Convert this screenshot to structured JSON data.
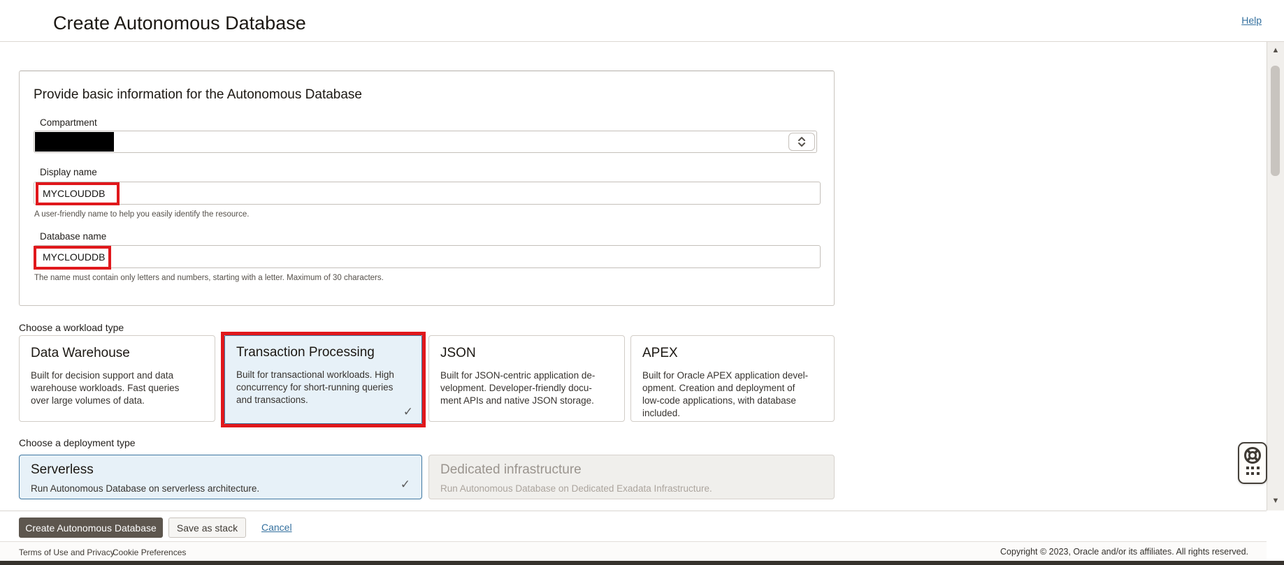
{
  "header": {
    "title": "Create Autonomous Database",
    "help_label": "Help"
  },
  "basic_info": {
    "heading": "Provide basic information for the Autonomous Database",
    "compartment": {
      "label": "Compartment"
    },
    "display_name": {
      "label": "Display name",
      "value": "MYCLOUDDB",
      "helper": "A user-friendly name to help you easily identify the resource."
    },
    "database_name": {
      "label": "Database name",
      "value": "MYCLOUDDB",
      "helper": "The name must contain only letters and numbers, starting with a letter. Maximum of 30 characters."
    }
  },
  "workload": {
    "label": "Choose a workload type",
    "cards": [
      {
        "title": "Data Warehouse",
        "description": [
          "Built for decision support and data",
          "warehouse workloads. Fast queries",
          "over large volumes of data."
        ],
        "selected": false
      },
      {
        "title": "Transaction Processing",
        "description": [
          "Built for transactional workloads. High",
          "concurrency for short-running queries",
          "and transactions."
        ],
        "selected": true
      },
      {
        "title": "JSON",
        "description": [
          "Built for JSON-centric application de-",
          "velopment. Developer-friendly docu-",
          "ment APIs and native JSON storage."
        ],
        "selected": false
      },
      {
        "title": "APEX",
        "description": [
          "Built for Oracle APEX application devel-",
          "opment. Creation and deployment of",
          "low-code applications, with database",
          "included."
        ],
        "selected": false
      }
    ]
  },
  "deployment": {
    "label": "Choose a deployment type",
    "cards": [
      {
        "title": "Serverless",
        "description": "Run Autonomous Database on serverless architecture.",
        "selected": true
      },
      {
        "title": "Dedicated infrastructure",
        "description": "Run Autonomous Database on Dedicated Exadata Infrastructure.",
        "selected": false,
        "disabled": true
      }
    ]
  },
  "actions": {
    "create_label": "Create Autonomous Database",
    "save_stack_label": "Save as stack",
    "cancel_label": "Cancel"
  },
  "footer": {
    "terms_label": "Terms of Use and Privacy",
    "cookies_label": "Cookie Preferences",
    "copyright": "Copyright © 2023, Oracle and/or its affiliates. All rights reserved."
  },
  "icons": {
    "check_glyph": "✓",
    "scroll_up_glyph": "▲",
    "scroll_down_glyph": "▼"
  },
  "colors": {
    "annotation_red": "#e0181c",
    "selected_card_bg": "#e7f1f8",
    "selected_card_border": "#4078a2",
    "primary_button_bg": "#5d564e",
    "link_blue": "#35719f",
    "redaction_black": "#000000"
  }
}
